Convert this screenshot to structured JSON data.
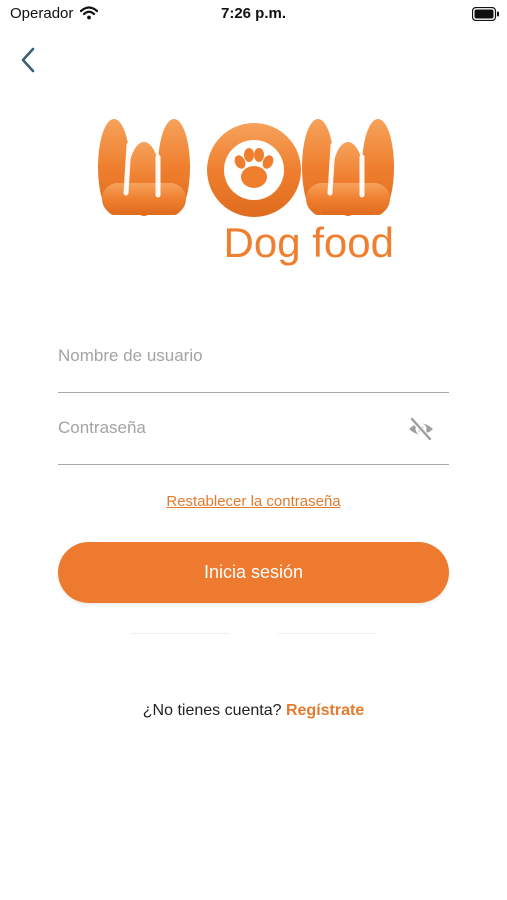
{
  "status_bar": {
    "carrier": "Operador",
    "time": "7:26 p.m."
  },
  "back_icon": "chevron-left-icon",
  "logo": {
    "word": "WOW",
    "subtitle": "Dog food",
    "brand_color": "#ef7f2f"
  },
  "form": {
    "username_placeholder": "Nombre de usuario",
    "username_value": "",
    "password_placeholder": "Contraseña",
    "password_value": "",
    "password_toggle_icon": "eye-slash-icon",
    "reset_link": "Restablecer la contraseña",
    "login_button": "Inicia sesión"
  },
  "signup": {
    "prompt": "¿No tienes cuenta?",
    "link": "Regístrate"
  },
  "colors": {
    "accent": "#ee7a2f",
    "link": "#e57a2e",
    "underline": "#a9a9a9",
    "placeholder": "#a3a3a3"
  }
}
